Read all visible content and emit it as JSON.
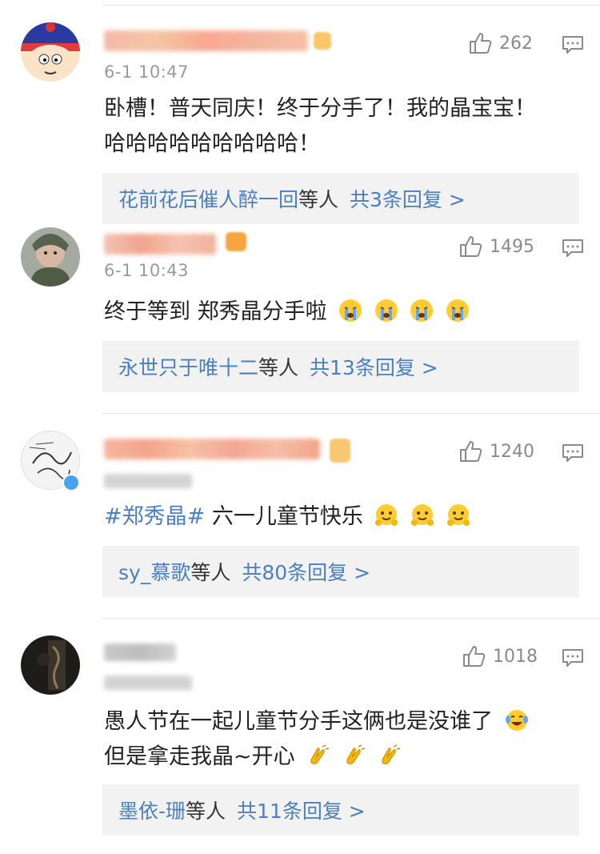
{
  "comments": [
    {
      "time": "6-1 10:47",
      "likes": "262",
      "text": "卧槽！普天同庆！终于分手了！我的晶宝宝！哈哈哈哈哈哈哈哈哈！",
      "reply_from": "花前花后催人醉一回",
      "reply_mid": "等人",
      "reply_count": "共3条回复 >"
    },
    {
      "time": "6-1 10:43",
      "likes": "1495",
      "text": "终于等到 郑秀晶分手啦",
      "reply_from": "永世只于唯十二",
      "reply_mid": "等人",
      "reply_count": "共13条回复 >"
    },
    {
      "likes": "1240",
      "tag": "#郑秀晶#",
      "text": " 六一儿童节快乐",
      "reply_from": "sy_慕歌",
      "reply_mid": "等人",
      "reply_count": "共80条回复 >"
    },
    {
      "likes": "1018",
      "text_line1": "愚人节在一起儿童节分手这俩也是没谁了",
      "text_line2": "但是拿走我晶~开心",
      "reply_from": "墨依-珊",
      "reply_mid": "等人",
      "reply_count": "共11条回复 >"
    }
  ],
  "icons": {
    "like": "thumbs-up-icon",
    "reply": "comment-icon",
    "emoji_cry": "crying-face-emoji",
    "emoji_hug": "hugging-face-emoji",
    "emoji_laugh": "tears-of-joy-emoji",
    "emoji_clap": "clapping-hands-emoji"
  },
  "colors": {
    "link": "#4b7fbf",
    "reply_bg": "#f2f2f2",
    "meta": "#9a9a9a"
  }
}
